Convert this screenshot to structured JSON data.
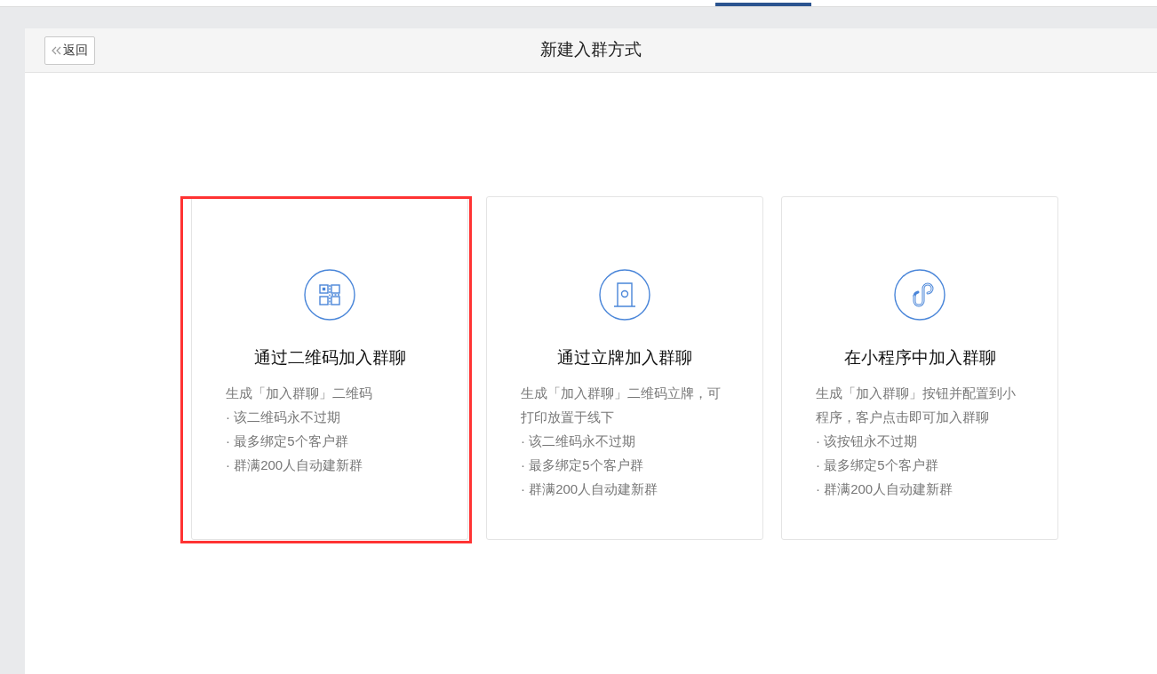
{
  "header": {
    "back_button": "返回",
    "title": "新建入群方式"
  },
  "cards": [
    {
      "kind": "qrcode",
      "title": "通过二维码加入群聊",
      "highlighted": true,
      "description": "生成「加入群聊」二维码",
      "bullets": [
        "· 该二维码永不过期",
        "· 最多绑定5个客户群",
        "· 群满200人自动建新群"
      ]
    },
    {
      "kind": "stand",
      "title": "通过立牌加入群聊",
      "highlighted": false,
      "description": "生成「加入群聊」二维码立牌，可打印放置于线下",
      "bullets": [
        "· 该二维码永不过期",
        "· 最多绑定5个客户群",
        "· 群满200人自动建新群"
      ]
    },
    {
      "kind": "miniprogram",
      "title": "在小程序中加入群聊",
      "highlighted": false,
      "description": "生成「加入群聊」按钮并配置到小程序，客户点击即可加入群聊",
      "bullets": [
        "· 该按钮永不过期",
        "· 最多绑定5个客户群",
        "· 群满200人自动建新群"
      ]
    }
  ]
}
